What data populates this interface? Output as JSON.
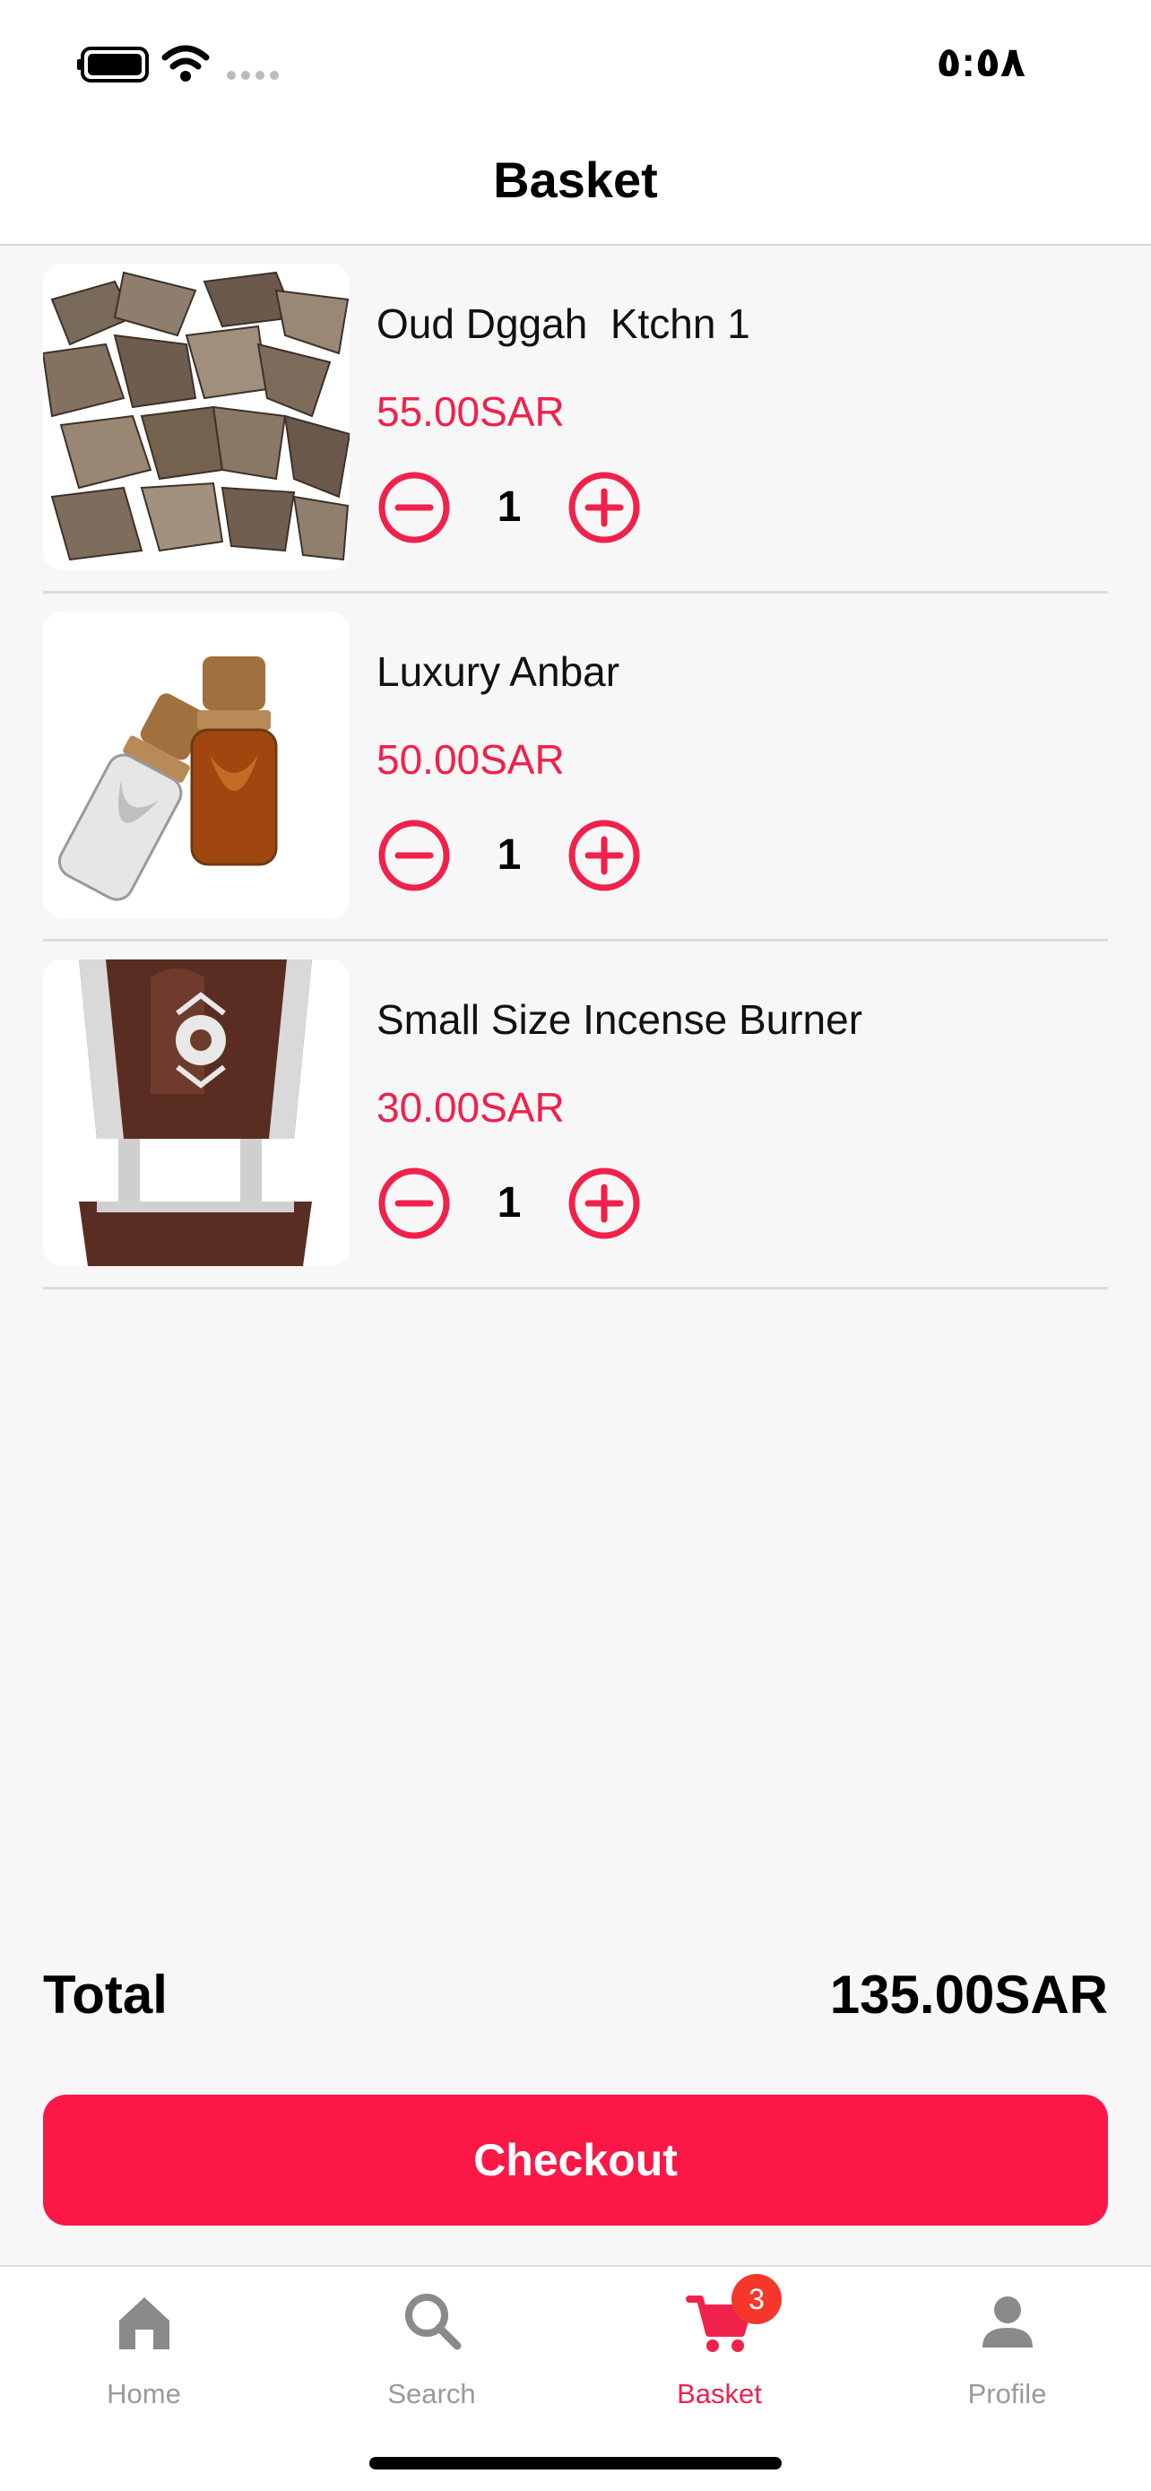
{
  "status_bar": {
    "time": "٥:٥٨"
  },
  "header": {
    "title": "Basket"
  },
  "items": [
    {
      "name": "Oud Dggah  Ktchn 1",
      "price": "55.00SAR",
      "quantity": "1",
      "image": "oud-wood-chips"
    },
    {
      "name": "Luxury Anbar",
      "price": "50.00SAR",
      "quantity": "1",
      "image": "perfume-oil-bottles"
    },
    {
      "name": "Small Size Incense Burner",
      "price": "30.00SAR",
      "quantity": "1",
      "image": "incense-burner"
    }
  ],
  "summary": {
    "total_label": "Total",
    "total_value": "135.00SAR"
  },
  "checkout_label": "Checkout",
  "tabs": [
    {
      "label": "Home",
      "icon": "home-icon"
    },
    {
      "label": "Search",
      "icon": "search-icon"
    },
    {
      "label": "Basket",
      "icon": "cart-icon",
      "badge": "3"
    },
    {
      "label": "Profile",
      "icon": "profile-icon"
    }
  ],
  "colors": {
    "accent": "#fb1847",
    "price": "#f0214b",
    "badge": "#f4362b",
    "inactive_tab": "#9a9a9a"
  }
}
